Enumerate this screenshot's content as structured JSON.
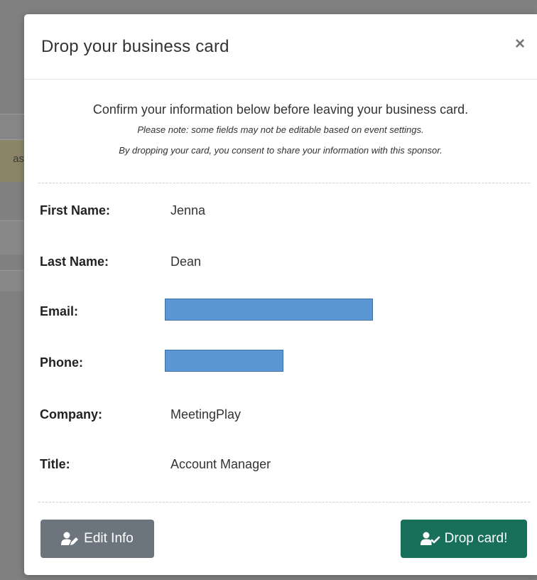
{
  "background": {
    "fragment_text": "as"
  },
  "modal": {
    "title": "Drop your business card",
    "close_label": "×",
    "intro": {
      "main": "Confirm your information below before leaving your business card.",
      "note": "Please note: some fields may not be editable based on event settings.",
      "consent": "By dropping your card, you consent to share your information with this sponsor."
    },
    "fields": {
      "first_name": {
        "label": "First Name:",
        "value": "Jenna"
      },
      "last_name": {
        "label": "Last Name:",
        "value": "Dean"
      },
      "email": {
        "label": "Email:"
      },
      "phone": {
        "label": "Phone:"
      },
      "company": {
        "label": "Company:",
        "value": "MeetingPlay"
      },
      "title": {
        "label": "Title:",
        "value": "Account Manager"
      }
    },
    "buttons": {
      "edit_label": "Edit Info",
      "drop_label": "Drop card!"
    }
  },
  "colors": {
    "edit_button": "#6c757d",
    "drop_button": "#18705a",
    "redaction": "#5b96d5"
  },
  "icons": {
    "edit": "user-edit-icon",
    "drop": "user-check-icon",
    "close": "close-icon"
  }
}
